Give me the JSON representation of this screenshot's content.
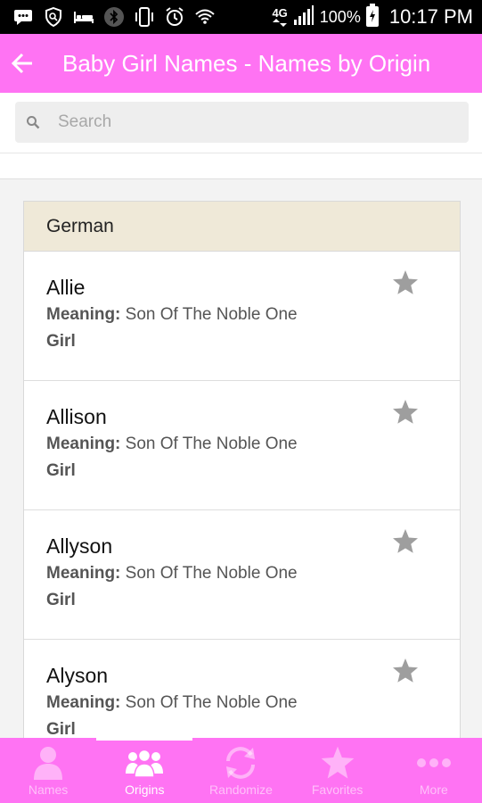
{
  "status_bar": {
    "icons": [
      "message-icon",
      "shield-icon",
      "bed-icon",
      "bluetooth-icon",
      "vibrate-icon",
      "alarm-icon",
      "wifi-icon",
      "lte-icon",
      "signal-icon"
    ],
    "network": "4G",
    "battery": "100%",
    "time": "10:17 PM"
  },
  "app_bar": {
    "title": "Baby Girl Names - Names by Origin",
    "back_icon": "arrow-left-icon",
    "color": "#ff73f3"
  },
  "search": {
    "placeholder": "Search",
    "value": "",
    "icon": "search-icon"
  },
  "group": {
    "header": "German",
    "header_color": "#efe9d8"
  },
  "names": [
    {
      "name": "Allie",
      "meaning_label": "Meaning:",
      "meaning": "Son Of The Noble One",
      "gender": "Girl",
      "favorite_icon": "star-icon"
    },
    {
      "name": "Allison",
      "meaning_label": "Meaning:",
      "meaning": "Son Of The Noble One",
      "gender": "Girl",
      "favorite_icon": "star-icon"
    },
    {
      "name": "Allyson",
      "meaning_label": "Meaning:",
      "meaning": "Son Of The Noble One",
      "gender": "Girl",
      "favorite_icon": "star-icon"
    },
    {
      "name": "Alyson",
      "meaning_label": "Meaning:",
      "meaning": "Son Of The Noble One",
      "gender": "Girl",
      "favorite_icon": "star-icon"
    }
  ],
  "bottom_nav": {
    "items": [
      {
        "label": "Names",
        "icon": "person-icon",
        "active": false
      },
      {
        "label": "Origins",
        "icon": "group-icon",
        "active": true
      },
      {
        "label": "Randomize",
        "icon": "refresh-icon",
        "active": false
      },
      {
        "label": "Favorites",
        "icon": "star-icon",
        "active": false
      },
      {
        "label": "More",
        "icon": "more-icon",
        "active": false
      }
    ]
  }
}
